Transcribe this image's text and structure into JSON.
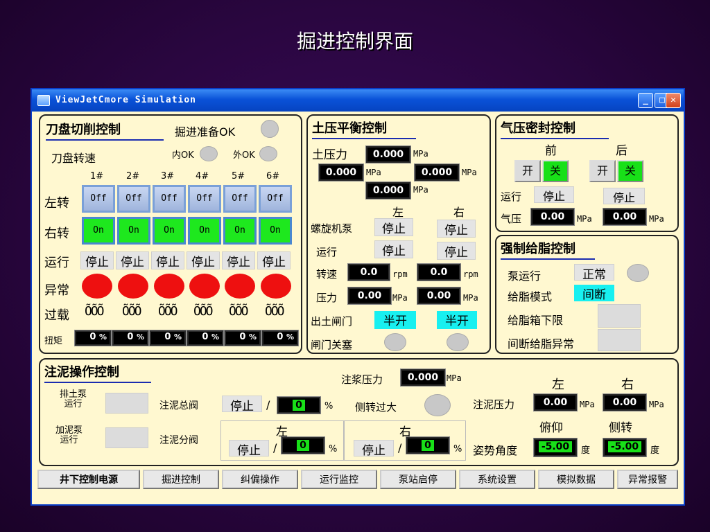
{
  "slide_title": "掘进控制界面",
  "window_title": "ViewJetCmore Simulation",
  "window_buttons": {
    "minimize": "_",
    "maximize": "□",
    "close": "✕"
  },
  "cutter": {
    "title": "刀盘切削控制",
    "ready_label": "掘进准备OK",
    "speed_label": "刀盘转速",
    "inner_ok": "内OK",
    "outer_ok": "外OK",
    "columns": [
      "1#",
      "2#",
      "3#",
      "4#",
      "5#",
      "6#"
    ],
    "left_label": "左转",
    "right_label": "右转",
    "run_label": "运行",
    "fault_label": "异常",
    "overload_label": "过载",
    "torque_label": "扭矩",
    "left_btns": [
      "Off",
      "Off",
      "Off",
      "Off",
      "Off",
      "Off"
    ],
    "right_btns": [
      "On",
      "On",
      "On",
      "On",
      "On",
      "On"
    ],
    "run_status": [
      "停止",
      "停止",
      "停止",
      "停止",
      "停止",
      "停止"
    ],
    "overload_glyphs": [
      "ÕÕÕ",
      "ÕÕÕ",
      "ÕÕÕ",
      "ÕÕÕ",
      "ÕÕÕ",
      "ÕÕÕ"
    ],
    "torque_values": [
      "0",
      "0",
      "0",
      "0",
      "0",
      "0"
    ],
    "torque_unit": "%"
  },
  "earth": {
    "title": "土压平衡控制",
    "pressure_label": "土压力",
    "p1": "0.000",
    "p2": "0.000",
    "p3": "0.000",
    "p4": "0.000",
    "unit_mpa": "MPa",
    "left": "左",
    "right": "右",
    "screw_label": "螺旋机泵",
    "screw_left": "停止",
    "screw_right": "停止",
    "run_label": "运行",
    "run_left": "停止",
    "run_right": "停止",
    "speed_label": "转速",
    "speed_left": "0.0",
    "speed_right": "0.0",
    "unit_rpm": "rpm",
    "press_label": "压力",
    "press_left": "0.00",
    "press_right": "0.00",
    "gate_label": "出土闸门",
    "gate_left": "半开",
    "gate_right": "半开",
    "gate_block_label": "闸门关塞"
  },
  "air": {
    "title": "气压密封控制",
    "front": "前",
    "back": "后",
    "open": "开",
    "close": "关",
    "run_label": "运行",
    "run_front": "停止",
    "run_back": "停止",
    "press_label": "气压",
    "press_front": "0.00",
    "press_back": "0.00",
    "unit": "MPa"
  },
  "grease": {
    "title": "强制给脂控制",
    "pump_label": "泵运行",
    "pump_status": "正常",
    "mode_label": "给脂模式",
    "mode_value": "间断",
    "low_label": "给脂箱下限",
    "fault_label": "间断给脂异常"
  },
  "mud": {
    "title": "注泥操作控制",
    "drain_pump_label": "排土泵\n运行",
    "add_pump_label": "加泥泵\n运行",
    "main_valve_label": "注泥总阀",
    "main_valve_status": "停止",
    "main_valve_value": "0",
    "pct": "%",
    "slurry_label": "注浆压力",
    "slurry_value": "0.000",
    "slurry_unit": "MPa",
    "side_over_label": "侧转过大",
    "branch_label": "注泥分阀",
    "left": "左",
    "right": "右",
    "branch_left_status": "停止",
    "branch_left_value": "0",
    "branch_right_status": "停止",
    "branch_right_value": "0",
    "inj_press_label": "注泥压力",
    "inj_left": "0.00",
    "inj_right": "0.00",
    "unit_mpa": "MPa",
    "pitch_label": "俯仰",
    "roll_label": "侧转",
    "attitude_label": "姿势角度",
    "pitch_value": "-5.00",
    "roll_value": "-5.00",
    "deg": "度"
  },
  "tabs": [
    "井下控制电源",
    "掘进控制",
    "纠偏操作",
    "运行监控",
    "泵站启停",
    "系统设置",
    "模拟数据",
    "异常报警"
  ]
}
